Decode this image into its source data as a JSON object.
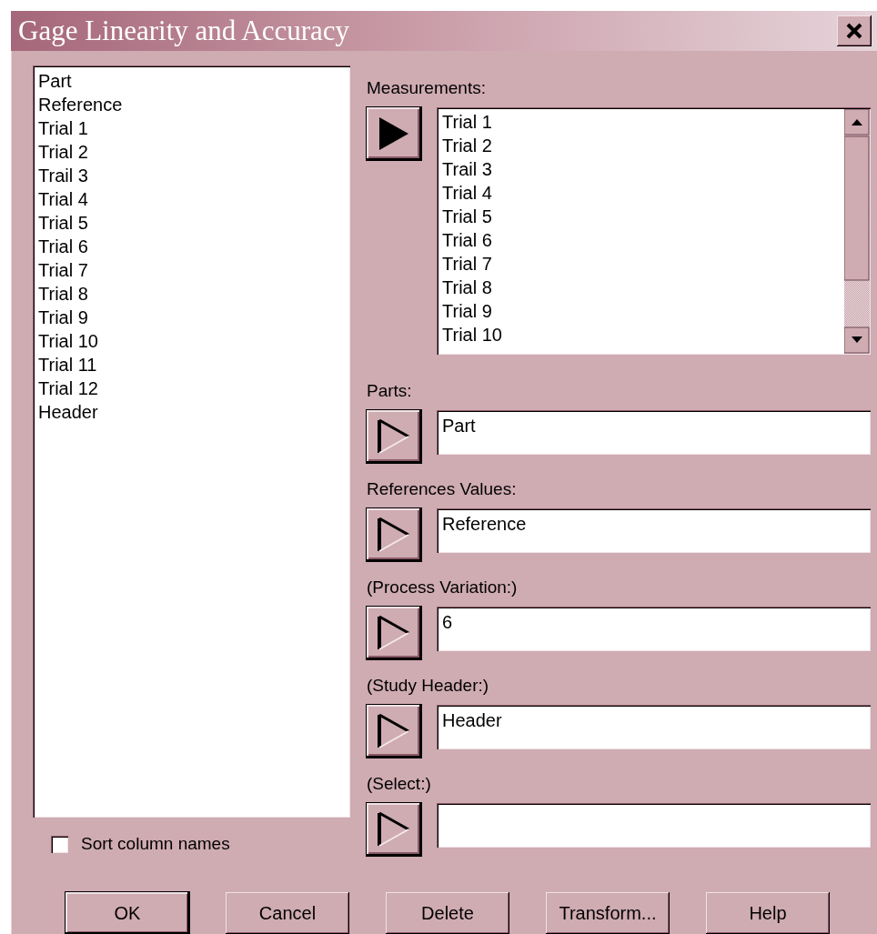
{
  "window": {
    "title": "Gage Linearity and Accuracy"
  },
  "columns": [
    "Part",
    "Reference",
    "Trial 1",
    "Trial 2",
    "Trail 3",
    "Trial 4",
    "Trial 5",
    "Trial 6",
    "Trial 7",
    "Trial 8",
    "Trial 9",
    "Trial 10",
    "Trial 11",
    "Trial 12",
    "Header"
  ],
  "measurements": {
    "label": "Measurements:",
    "active": true,
    "items": [
      "Trial 1",
      "Trial 2",
      "Trail 3",
      "Trial 4",
      "Trial 5",
      "Trial 6",
      "Trial 7",
      "Trial 8",
      "Trial 9",
      "Trial 10"
    ]
  },
  "fields": [
    {
      "label": "Parts:",
      "value": "Part",
      "active": false
    },
    {
      "label": "References Values:",
      "value": "Reference",
      "active": false
    },
    {
      "label": "(Process Variation:)",
      "value": "6",
      "active": false
    },
    {
      "label": "(Study Header:)",
      "value": "Header",
      "active": false
    },
    {
      "label": "(Select:)",
      "active": false
    }
  ],
  "sort_column_names": {
    "label": "Sort column names",
    "checked": false
  },
  "buttons": [
    {
      "label": "OK",
      "default": true
    },
    {
      "label": "Cancel",
      "default": false
    },
    {
      "label": "Delete",
      "default": false
    },
    {
      "label": "Transform...",
      "default": false
    },
    {
      "label": "Help",
      "default": false
    }
  ]
}
